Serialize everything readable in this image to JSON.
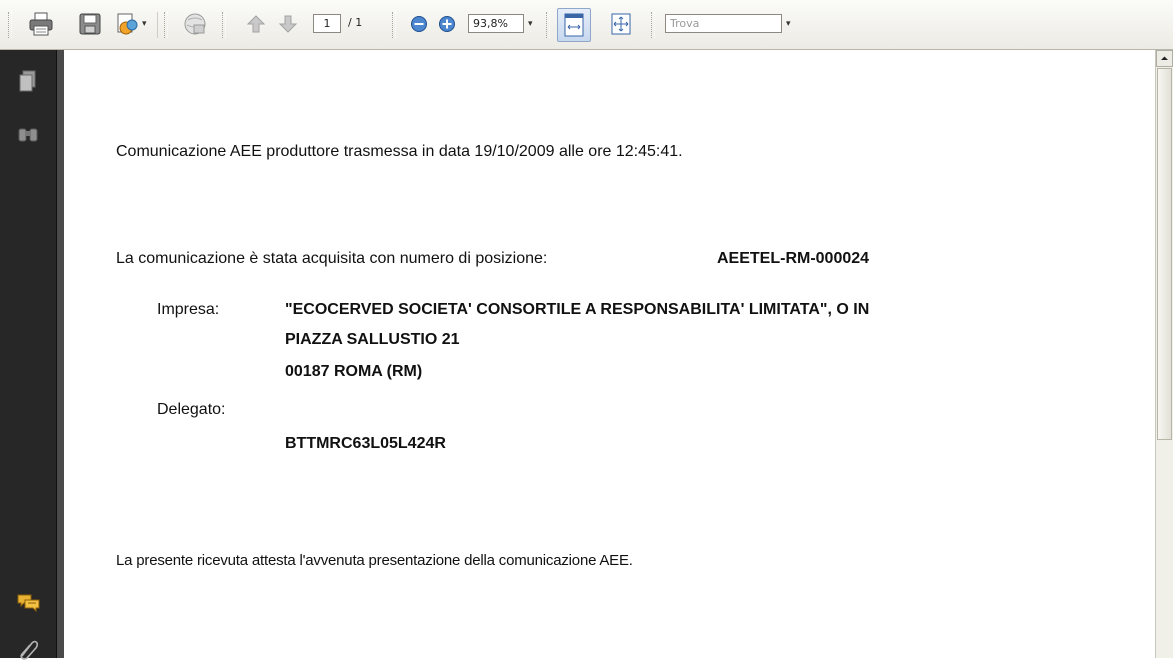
{
  "toolbar": {
    "page_current": "1",
    "page_total": "/ 1",
    "zoom_value": "93,8%",
    "find_placeholder": "Trova"
  },
  "icons": {
    "print": "print-icon",
    "save": "save-icon",
    "share": "share-icon",
    "web": "web-icon",
    "prev": "arrow-up-icon",
    "next": "arrow-down-icon",
    "zoom_out": "zoom-out-icon",
    "zoom_in": "zoom-in-icon",
    "fit_width": "fit-width-icon",
    "fit_page": "fit-page-icon",
    "pages": "pages-icon",
    "search": "binoculars-icon",
    "comments": "comments-icon",
    "attach": "paperclip-icon"
  },
  "document": {
    "line1": "Comunicazione AEE produttore trasmessa in data 19/10/2009 alle ore 12:45:41.",
    "line2_label": "La comunicazione è stata acquisita con numero di posizione:",
    "line2_value": "AEETEL-RM-000024",
    "impresa_label": "Impresa:",
    "impresa_name": "\"ECOCERVED SOCIETA' CONSORTILE A RESPONSABILITA' LIMITATA\", O IN",
    "impresa_address": "PIAZZA SALLUSTIO 21",
    "impresa_city": "00187 ROMA (RM)",
    "delegato_label": "Delegato:",
    "delegato_value": "BTTMRC63L05L424R",
    "footer": "La presente ricevuta attesta l'avvenuta presentazione della comunicazione AEE."
  },
  "colors": {
    "nav_panel": "#272727",
    "toolbar": "#ecebe5",
    "toggle_active": "#c7d8ef"
  }
}
